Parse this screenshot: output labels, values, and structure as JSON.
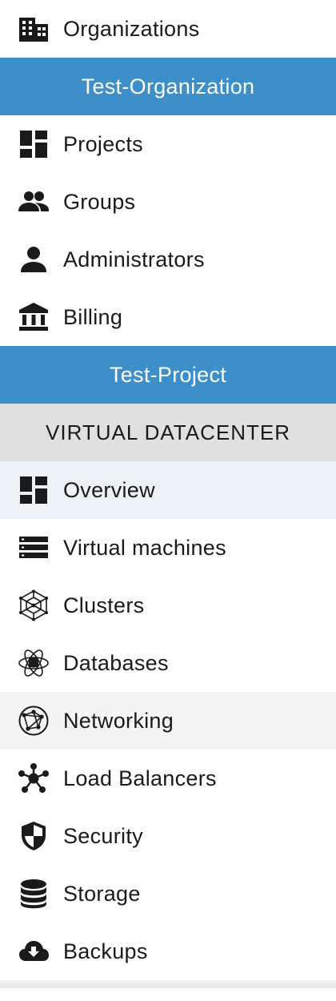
{
  "nav": {
    "organizations": {
      "label": "Organizations",
      "icon": "building-icon"
    },
    "organization_header": "Test-Organization",
    "org_items": [
      {
        "label": "Projects",
        "icon": "dashboard-icon"
      },
      {
        "label": "Groups",
        "icon": "people-icon"
      },
      {
        "label": "Administrators",
        "icon": "person-icon"
      },
      {
        "label": "Billing",
        "icon": "bank-icon"
      }
    ],
    "project_header": "Test-Project",
    "section_title": "VIRTUAL DATACENTER",
    "project_items": [
      {
        "label": "Overview",
        "icon": "dashboard-icon",
        "state": "active"
      },
      {
        "label": "Virtual machines",
        "icon": "server-icon"
      },
      {
        "label": "Clusters",
        "icon": "cluster-icon"
      },
      {
        "label": "Databases",
        "icon": "database-atom-icon"
      },
      {
        "label": "Networking",
        "icon": "globe-network-icon",
        "state": "hover"
      },
      {
        "label": "Load Balancers",
        "icon": "hub-icon"
      },
      {
        "label": "Security",
        "icon": "shield-icon"
      },
      {
        "label": "Storage",
        "icon": "storage-icon"
      },
      {
        "label": "Backups",
        "icon": "cloud-download-icon"
      }
    ]
  },
  "colors": {
    "header_blue": "#3d8fca",
    "section_gray": "#e0e0e0",
    "active_bg": "#ebf1f5",
    "hover_bg": "#f4f4f4"
  }
}
